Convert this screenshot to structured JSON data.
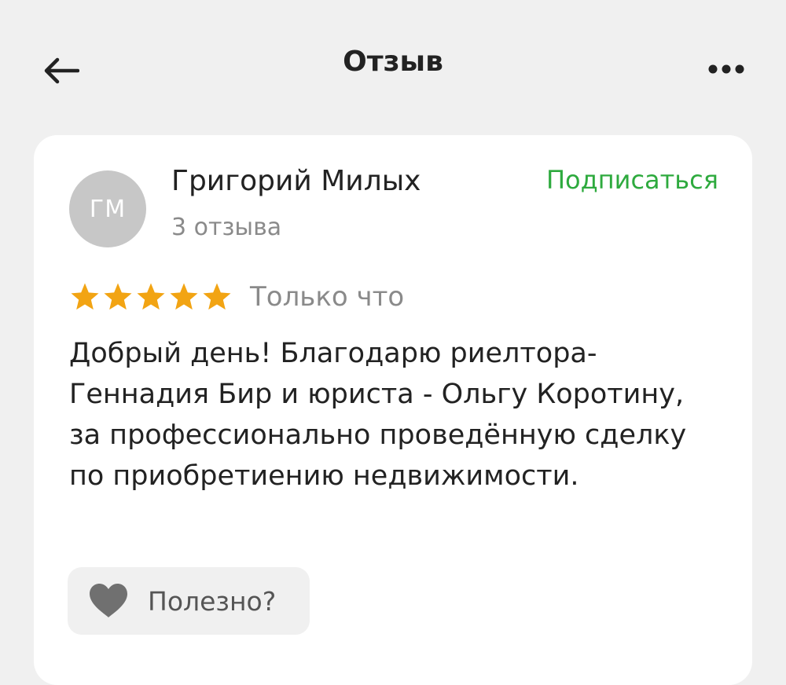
{
  "header": {
    "title": "Отзыв",
    "back_icon": "arrow-left-icon",
    "more_icon": "more-horizontal-icon"
  },
  "review": {
    "author": {
      "initials": "ГМ",
      "name": "Григорий Милых",
      "reviews_count_text": "3 отзыва"
    },
    "subscribe_label": "Подписаться",
    "rating": 5,
    "max_rating": 5,
    "time": "Только что",
    "text": "Добрый день! Благодарю риелтора-Геннадия Бир и юриста - Ольгу Коротину, за профессионально проведённую сделку по приобретиению недвижимости.",
    "helpful_label": "Полезно?",
    "helpful_icon": "heart-icon"
  },
  "colors": {
    "accent_green": "#2eaa3e",
    "star_gold": "#f2a413",
    "avatar_bg": "#c7c7c7",
    "background": "#f0f0f0"
  }
}
